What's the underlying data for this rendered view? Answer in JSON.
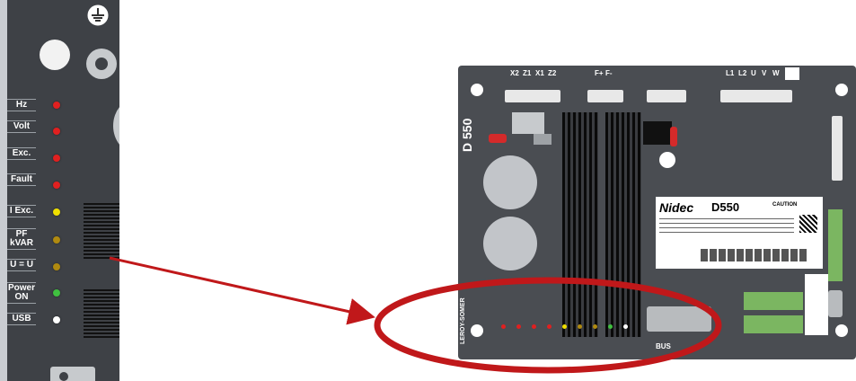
{
  "left_panel": {
    "labels": [
      {
        "text": "Hz"
      },
      {
        "text": "Volt"
      },
      {
        "text": "Exc."
      },
      {
        "text": "Fault"
      },
      {
        "text": "I Exc."
      },
      {
        "text": "PF kVAR"
      },
      {
        "text": "U = U"
      },
      {
        "text": "Power ON"
      },
      {
        "text": "USB"
      }
    ],
    "led_colors": [
      "#e02020",
      "#e02020",
      "#e02020",
      "#e02020",
      "#f0e000",
      "#b08a10",
      "#b08a10",
      "#40c040",
      "#ffffff"
    ]
  },
  "board": {
    "model_vertical": "D 550",
    "brand_vertical": "LEROY-SOMER",
    "connector_labels": [
      "X2",
      "Z1",
      "X1",
      "Z2",
      "F+",
      "F-",
      "L1",
      "L2",
      "U",
      "V",
      "W"
    ],
    "logo": "Nidec",
    "model": "D550",
    "caution": "CAUTION",
    "bus_label": "BUS"
  },
  "colors": {
    "board": "#4a4d52",
    "panel": "#3e4146",
    "arrow": "#c0181a",
    "ellipse": "#c0181a",
    "terminal_green": "#7bb661"
  }
}
